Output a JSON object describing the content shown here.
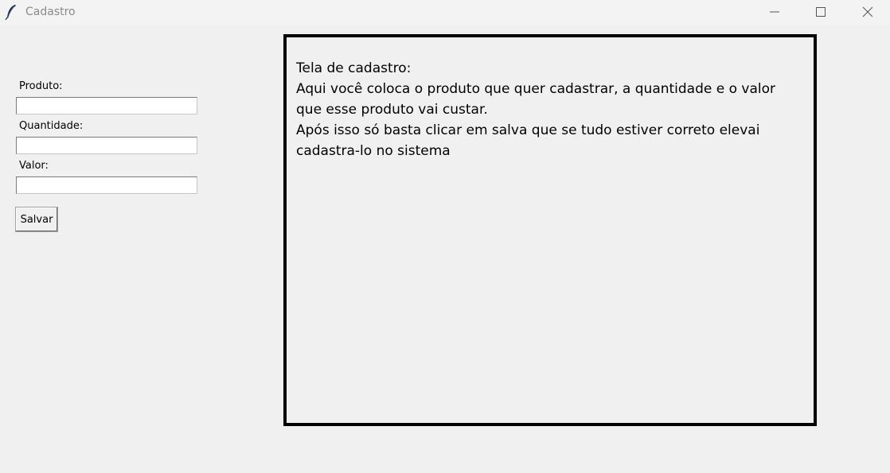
{
  "window": {
    "title": "Cadastro",
    "icon": "feather-icon",
    "controls": [
      "minimize-icon",
      "maximize-icon",
      "close-icon"
    ]
  },
  "form": {
    "produto_label": "Produto:",
    "produto_value": "",
    "quantidade_label": "Quantidade:",
    "quantidade_value": "",
    "valor_label": "Valor:",
    "valor_value": "",
    "save_label": "Salvar"
  },
  "info": {
    "text": "Tela de cadastro:\nAqui você coloca o produto que quer cadastrar, a quantidade e o valor\nque esse produto vai custar.\nApós isso só basta clicar em salva que se tudo estiver correto elevai\ncadastra-lo no sistema"
  },
  "colors": {
    "background": "#f0f0f0",
    "panel_border": "#000000"
  }
}
